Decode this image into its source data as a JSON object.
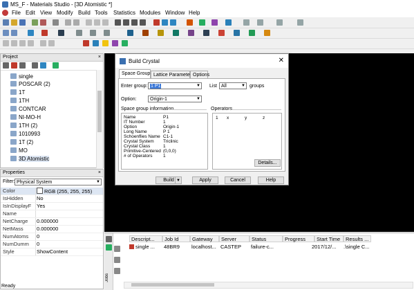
{
  "window": {
    "title": "MS_F - Materials Studio - [3D Atomistic *]"
  },
  "menu": [
    "File",
    "Edit",
    "View",
    "Modify",
    "Build",
    "Tools",
    "Statistics",
    "Modules",
    "Window",
    "Help"
  ],
  "project": {
    "header": "Project",
    "items": [
      "single",
      "POSCAR (2)",
      "1T",
      "1TH",
      "CONTCAR",
      "NI-MO-H",
      "1TH (2)",
      "1010993",
      "1T (2)",
      "MO",
      "3D Atomistic"
    ]
  },
  "properties": {
    "header": "Properties",
    "filter_label": "Filter:",
    "filter_value": "Physical System",
    "rows": [
      {
        "k": "Color",
        "v": "RGB (255, 255, 255)"
      },
      {
        "k": "IsHidden",
        "v": "No"
      },
      {
        "k": "IsInDisplayF",
        "v": "Yes"
      },
      {
        "k": "Name",
        "v": ""
      },
      {
        "k": "NetCharge",
        "v": "0.000000"
      },
      {
        "k": "NetMass",
        "v": "0.000000"
      },
      {
        "k": "NumAtoms",
        "v": "0"
      },
      {
        "k": "NumDumm",
        "v": "0"
      },
      {
        "k": "Style",
        "v": "ShowContent"
      }
    ]
  },
  "dialog": {
    "title": "Build Crystal",
    "tabs": [
      "Space Group",
      "Lattice Parameters",
      "Options"
    ],
    "enter_group_label": "Enter group:",
    "enter_group_value": "1 P1",
    "list_label": "List",
    "list_value": "All",
    "groups_label": "groups",
    "option_label": "Option:",
    "option_value": "Origin-1",
    "info_header": "Space group information",
    "operators_header": "Operators",
    "info": [
      {
        "k": "Name",
        "v": "P1"
      },
      {
        "k": "IT Number",
        "v": "1"
      },
      {
        "k": "Option",
        "v": "Origin-1"
      },
      {
        "k": "Long Name",
        "v": "P 1"
      },
      {
        "k": "Schoenflies Name",
        "v": "C1-1"
      },
      {
        "k": "Crystal System",
        "v": "Triclinic"
      },
      {
        "k": "Crystal Class",
        "v": "1"
      },
      {
        "k": "Primitive-Centered",
        "v": "(0,0,0)"
      },
      {
        "k": "# of Operators",
        "v": "1"
      }
    ],
    "operators": [
      "1",
      "x",
      "y",
      "z"
    ],
    "details_button": "Details...",
    "buttons": {
      "build": "Build",
      "apply": "Apply",
      "cancel": "Cancel",
      "help": "Help"
    }
  },
  "jobs": {
    "side_label": "Jobs",
    "columns": [
      "Descript...",
      "Job Id",
      "Gateway",
      "Server",
      "Status",
      "Progress",
      "Start Time",
      "Results ..."
    ],
    "row": [
      "single ...",
      "48BR9",
      "localhost...",
      "CASTEP",
      "failure-c...",
      "",
      "2017/12/...",
      ".\\single C..."
    ]
  },
  "status": {
    "text": "Ready"
  },
  "colors": {
    "canvas": "#000000",
    "selection": "#3b78d8",
    "property_color_swatch": "#ffffff"
  }
}
